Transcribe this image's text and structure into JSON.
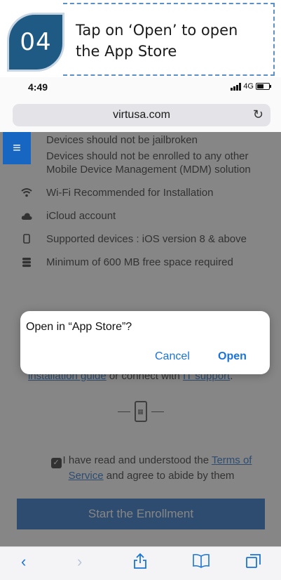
{
  "step": {
    "number": "04",
    "instruction": "Tap on ‘Open’ to open the App Store"
  },
  "status_bar": {
    "time": "4:49",
    "network": "4G"
  },
  "browser": {
    "url": "virtusa.com"
  },
  "requirements": [
    {
      "icon": "",
      "text": "Devices should not be jailbroken"
    },
    {
      "icon": "",
      "text": "Devices should not be enrolled to any other Mobile Device Management (MDM) solution"
    },
    {
      "icon": "wifi-icon",
      "text": "Wi-Fi Recommended for Installation"
    },
    {
      "icon": "cloud-icon",
      "text": "iCloud account"
    },
    {
      "icon": "phone-icon",
      "text": "Supported devices : iOS version 8 & above"
    },
    {
      "icon": "storage-icon",
      "text": "Minimum of 600 MB free space required"
    }
  ],
  "help": {
    "guide_link": "installation guide",
    "middle_text": " or connect with ",
    "support_link": "IT support",
    "end": "."
  },
  "terms": {
    "prefix": "I have read and understood the ",
    "link": "Terms of Service",
    "suffix": " and agree to abide by them"
  },
  "enroll_button": "Start the Enrollment",
  "alert": {
    "title": "Open in “App Store”?",
    "cancel": "Cancel",
    "open": "Open"
  },
  "colors": {
    "badge": "#1f5a85",
    "accent": "#1766c2",
    "ios_blue": "#1a73d9"
  }
}
